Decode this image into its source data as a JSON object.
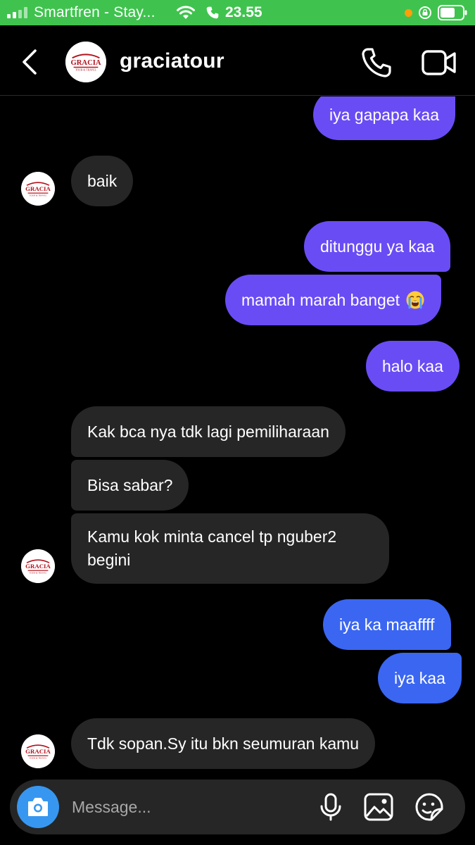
{
  "status_bar": {
    "carrier": "Smartfren - Stay...",
    "time": "23.55"
  },
  "header": {
    "username": "graciatour",
    "avatar_logo": "GRACIA TOUR & TRAVEL"
  },
  "messages": [
    {
      "id": "m1",
      "direction": "outgoing",
      "text": "iya gapapa kaa"
    },
    {
      "id": "m2",
      "direction": "incoming",
      "text": "baik"
    },
    {
      "id": "m3",
      "direction": "outgoing",
      "text": "ditunggu ya kaa"
    },
    {
      "id": "m4",
      "direction": "outgoing",
      "text": "mamah marah banget",
      "emoji": "loudly-crying-face"
    },
    {
      "id": "m5",
      "direction": "outgoing",
      "text": "halo kaa"
    },
    {
      "id": "m6",
      "direction": "incoming",
      "text": "Kak bca nya tdk lagi pemiliharaan"
    },
    {
      "id": "m7",
      "direction": "incoming",
      "text": "Bisa sabar?"
    },
    {
      "id": "m8",
      "direction": "incoming",
      "text": "Kamu kok minta cancel tp nguber2 begini"
    },
    {
      "id": "m9",
      "direction": "outgoing",
      "text": "iya ka maaffff"
    },
    {
      "id": "m10",
      "direction": "outgoing",
      "text": "iya kaa"
    },
    {
      "id": "m11",
      "direction": "incoming",
      "text": "Tdk sopan.Sy itu bkn seumuran kamu"
    }
  ],
  "composer": {
    "placeholder": "Message..."
  },
  "colors": {
    "statusbar": "#3fc34e",
    "outgoing_purple": "#6a4cf5",
    "outgoing_blue": "#3a66f2",
    "incoming": "#262626",
    "camera_button": "#3797f0",
    "logo_red": "#b3121c"
  },
  "icons": {
    "back": "chevron-left-icon",
    "call": "phone-icon",
    "video": "video-camera-icon",
    "camera": "camera-icon",
    "mic": "microphone-icon",
    "gallery": "image-icon",
    "sticker": "sticker-icon"
  }
}
